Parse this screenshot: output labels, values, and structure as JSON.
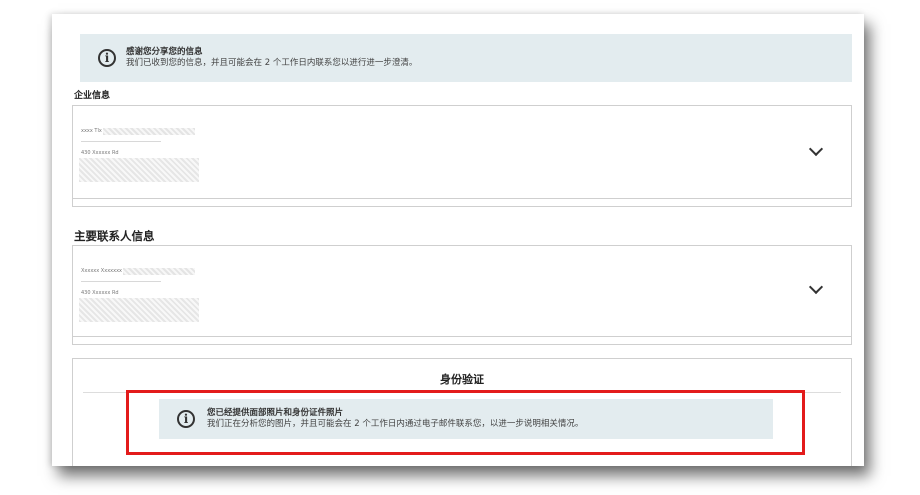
{
  "top_banner": {
    "icon": "info-icon",
    "title": "感谢您分享您的信息",
    "body": "我们已收到您的信息，并且可能会在 2 个工作日内联系您以进行进一步澄清。"
  },
  "company_section": {
    "label": "企业信息",
    "line1": "xxxx Tlx",
    "line2": "430 Xxxxxx Rd"
  },
  "contact_section": {
    "label": "主要联系人信息",
    "line1": "Xxxxxx Xxxxxxx xx",
    "line2": "430 Xxxxxx Rd"
  },
  "identity_section": {
    "title": "身份验证",
    "info_icon": "info-icon",
    "info_title": "您已经提供面部照片和身份证件照片",
    "info_body": "我们正在分析您的图片，并且可能会在 2 个工作日内通过电子邮件联系您，以进一步说明相关情况。"
  },
  "colors": {
    "banner_bg": "#e3ecef",
    "highlight": "#e31b1b"
  }
}
